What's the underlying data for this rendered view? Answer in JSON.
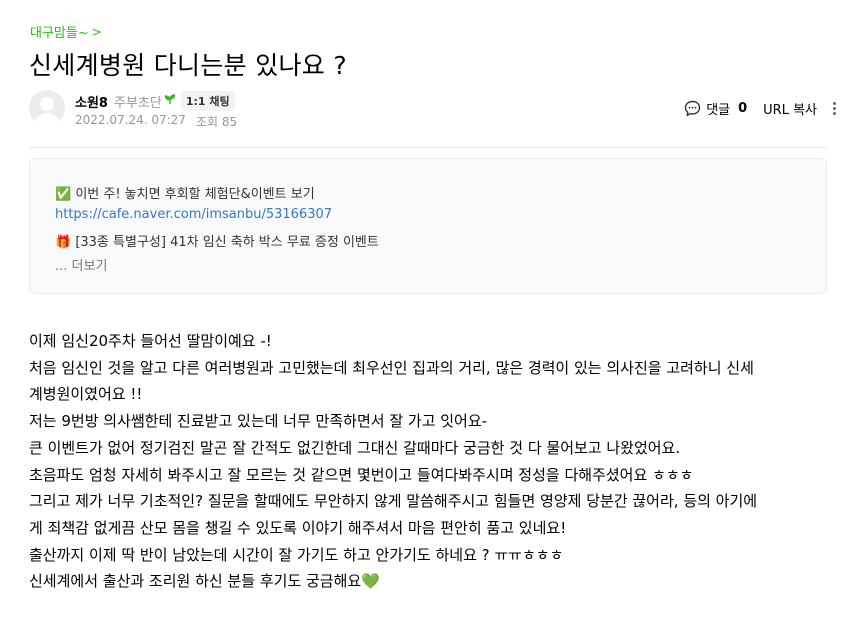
{
  "board": {
    "name": "대구맘들~",
    "chevron": ">"
  },
  "title": "신세계병원 다니는분 있나요 ?",
  "author": {
    "nickname": "소원8",
    "level": "주부초단",
    "badge_icon": "leaf-icon",
    "chat_label": "1:1 채팅",
    "date": "2022.07.24. 07:27",
    "views": "조회 85"
  },
  "tools": {
    "comment_label": "댓글",
    "comment_count": "0",
    "url_copy_label": "URL 복사"
  },
  "notice": {
    "line1": "✅ 이번 주! 놓치면 후회할 체험단&이벤트 보기",
    "link": "https://cafe.naver.com/imsanbu/53166307",
    "line3": "🎁 [33종 특별구성] 41차 임신 축하 박스 무료 증정 이벤트",
    "more": "... 더보기"
  },
  "content": {
    "lines": [
      "이제 임신20주차 들어선 딸맘이예요 -!",
      "처음 임신인 것을 알고 다른 여러병원과 고민했는데 최우선인 집과의 거리, 많은 경력이 있는 의사진을 고려하니 신세",
      "계병원이였어요 !!",
      "저는 9번방 의사쌤한테 진료받고 있는데 너무 만족하면서 잘 가고 잇어요-",
      "큰 이벤트가 없어 정기검진 말곤 잘 간적도 없긴한데 그대신 갈때마다 궁금한 것 다 물어보고 나왔었어요.",
      "초음파도 엄청 자세히 봐주시고 잘 모르는 것 같으면 몇번이고 들여다봐주시며 정성을 다해주셨어요 ㅎㅎㅎ",
      "그리고 제가 너무 기초적인? 질문을 할때에도 무안하지 않게 말씀해주시고 힘들면 영양제 당분간 끊어라, 등의 아기에",
      "게 죄책감 없게끔 산모 몸을 챙길 수 있도록 이야기 해주셔서 마음 편안히 품고 있네요!",
      "출산까지 이제 딱 반이 남았는데 시간이 잘 가기도 하고 안가기도 하네요 ? ㅠㅠㅎㅎㅎ",
      "신세계에서 출산과 조리원 하신 분들 후기도 궁금해요"
    ],
    "last_line_emoji": "💚"
  },
  "colors": {
    "board_link": "#1ec800",
    "link": "#3776c9",
    "notice_bg": "#f8f9fa"
  }
}
